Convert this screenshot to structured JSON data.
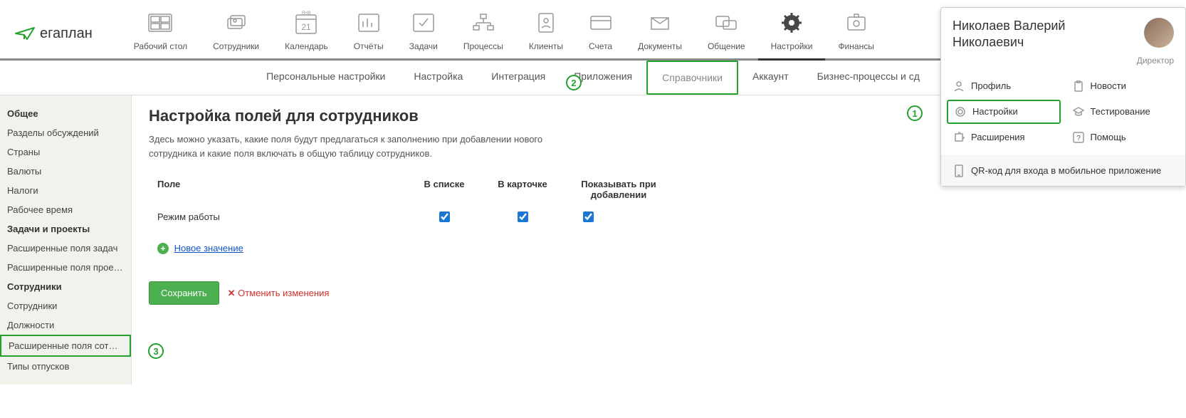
{
  "logo": "егаплан",
  "nav": [
    {
      "label": "Рабочий стол"
    },
    {
      "label": "Сотрудники"
    },
    {
      "label": "Календарь",
      "badge": "21",
      "top": "ЯНВ"
    },
    {
      "label": "Отчёты"
    },
    {
      "label": "Задачи"
    },
    {
      "label": "Процессы"
    },
    {
      "label": "Клиенты"
    },
    {
      "label": "Счета"
    },
    {
      "label": "Документы"
    },
    {
      "label": "Общение"
    },
    {
      "label": "Настройки"
    },
    {
      "label": "Финансы"
    }
  ],
  "subnav": [
    {
      "label": "Персональные настройки"
    },
    {
      "label": "Настройка"
    },
    {
      "label": "Интеграция"
    },
    {
      "label": "Приложения"
    },
    {
      "label": "Справочники",
      "selected": true
    },
    {
      "label": "Аккаунт"
    },
    {
      "label": "Бизнес-процессы и сд"
    }
  ],
  "sidebar": {
    "groups": [
      {
        "title": "Общее",
        "items": [
          "Разделы обсуждений",
          "Страны",
          "Валюты",
          "Налоги",
          "Рабочее время"
        ]
      },
      {
        "title": "Задачи и проекты",
        "items": [
          "Расширенные поля задач",
          "Расширенные поля проек…"
        ]
      },
      {
        "title": "Сотрудники",
        "items": [
          "Сотрудники",
          "Должности",
          "Расширенные поля сотру…",
          "Типы отпусков"
        ],
        "activeIdx": 2
      }
    ]
  },
  "main": {
    "title": "Настройка полей для сотрудников",
    "desc": "Здесь можно указать, какие поля будут предлагаться к заполнению при добавлении нового сотрудника и какие поля включать в общую таблицу сотрудников.",
    "cols": {
      "field": "Поле",
      "c1": "В списке",
      "c2": "В карточке",
      "c3": "Показывать при добавлении"
    },
    "rows": [
      {
        "name": "Режим работы",
        "c1": true,
        "c2": true,
        "c3": true
      }
    ],
    "add": "Новое значение",
    "save": "Сохранить",
    "cancel": "Отменить изменения"
  },
  "user": {
    "name": "Николаев Валерий Николаевич",
    "role": "Директор",
    "menu": [
      {
        "label": "Профиль",
        "icon": "person"
      },
      {
        "label": "Новости",
        "icon": "clip"
      },
      {
        "label": "Настройки",
        "icon": "gear",
        "sel": true
      },
      {
        "label": "Тестирование",
        "icon": "school"
      },
      {
        "label": "Расширения",
        "icon": "puzzle"
      },
      {
        "label": "Помощь",
        "icon": "help"
      }
    ],
    "qr": "QR-код для входа в мобильное приложение"
  },
  "badges": {
    "b1": "1",
    "b2": "2",
    "b3": "3"
  }
}
